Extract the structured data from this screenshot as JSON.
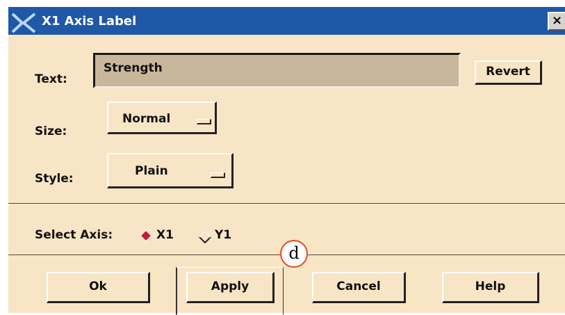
{
  "window": {
    "title": "X1 Axis Label",
    "app_icon": "x-logo-icon",
    "close_glyph": "×"
  },
  "form": {
    "text_label": "Text:",
    "text_value": "Strength",
    "revert_label": "Revert",
    "size_label": "Size:",
    "size_value": "Normal",
    "style_label": "Style:",
    "style_value": "Plain"
  },
  "axis": {
    "label": "Select Axis:",
    "options": [
      {
        "label": "X1",
        "selected": true
      },
      {
        "label": "Y1",
        "selected": false
      }
    ]
  },
  "buttons": {
    "ok": "Ok",
    "apply": "Apply",
    "cancel": "Cancel",
    "help": "Help"
  },
  "annotation": {
    "marker": "d"
  },
  "colors": {
    "titlebar": "#1e58a6",
    "dialog_bg": "#f8e5c6",
    "field_bg": "#c8b79a",
    "radio_selected": "#cc1a2e",
    "callout_border": "#e8491d"
  }
}
